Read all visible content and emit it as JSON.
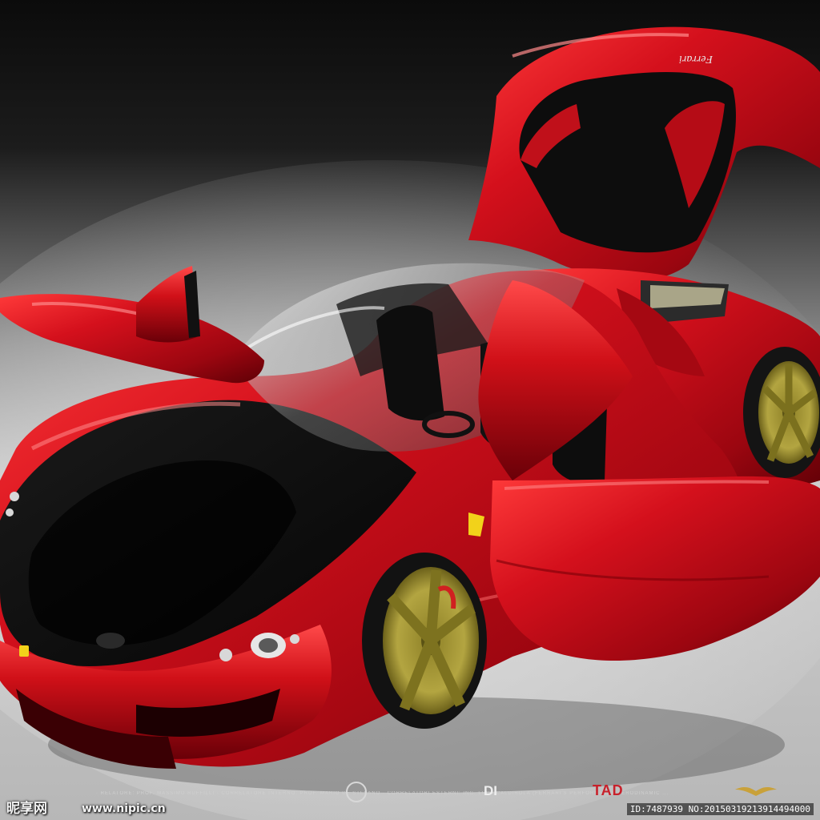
{
  "image": {
    "subject": "red Ferrari concept supercar",
    "colors": {
      "body_red": "#c8101a",
      "body_dark": "#7a0008",
      "highlight": "#ff6a6a",
      "wheel_gold": "#a89a34",
      "tire": "#151515",
      "backdrop_top": "#0e0e0e",
      "backdrop_floor": "#c9c9c9"
    }
  },
  "watermark": {
    "brand": "昵享网",
    "url": "www.nipic.cn",
    "id_text": "ID:7487939 NO:20150319213914494000"
  },
  "credits": {
    "line": "· RELATORE: PROF. MASSIMO RUFFILLI · CORRELATORE INTERNO: PROF. MARIO DE STEFANO · CORRELATORI ESTERNI: ING. LUCA CALDIROLA (FERRARI'S PERFORMANCE AERODINAMIC ...",
    "di_logo": "DI",
    "tad_logo": "TAD"
  },
  "badges": {
    "rear_script": "Ferrari"
  }
}
